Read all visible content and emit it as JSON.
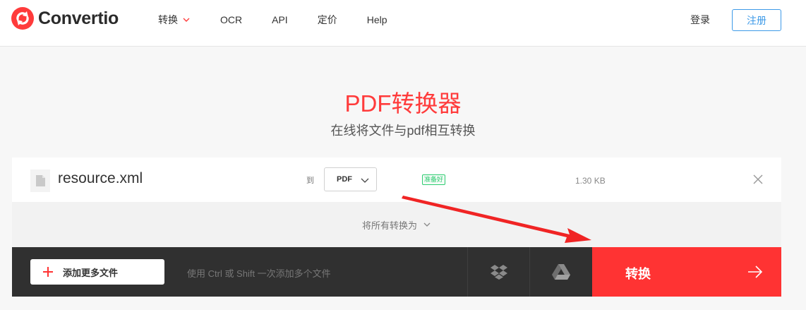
{
  "header": {
    "logo_text": "Convertio",
    "nav": [
      {
        "label": "转换"
      },
      {
        "label": "OCR"
      },
      {
        "label": "API"
      },
      {
        "label": "定价"
      },
      {
        "label": "Help"
      }
    ],
    "login_label": "登录",
    "signup_label": "注册"
  },
  "hero": {
    "title": "PDF转换器",
    "subtitle": "在线将文件与pdf相互转换"
  },
  "file": {
    "name": "resource.xml",
    "to_label": "到",
    "format": "PDF",
    "status": "准备好",
    "size": "1.30 KB"
  },
  "convert_all": {
    "label": "将所有转换为"
  },
  "bottom_bar": {
    "add_files_label": "添加更多文件",
    "hint": "使用 Ctrl 或 Shift 一次添加多个文件",
    "convert_label": "转换"
  },
  "colors": {
    "brand_red": "#ff3333",
    "signup_blue": "#3d9ae8",
    "status_green": "#2ecc71",
    "bar_dark": "#303030"
  },
  "icons": [
    "convertio-logo-icon",
    "chevron-down-icon",
    "file-icon",
    "close-icon",
    "plus-icon",
    "dropbox-icon",
    "google-drive-icon",
    "arrow-right-icon"
  ]
}
